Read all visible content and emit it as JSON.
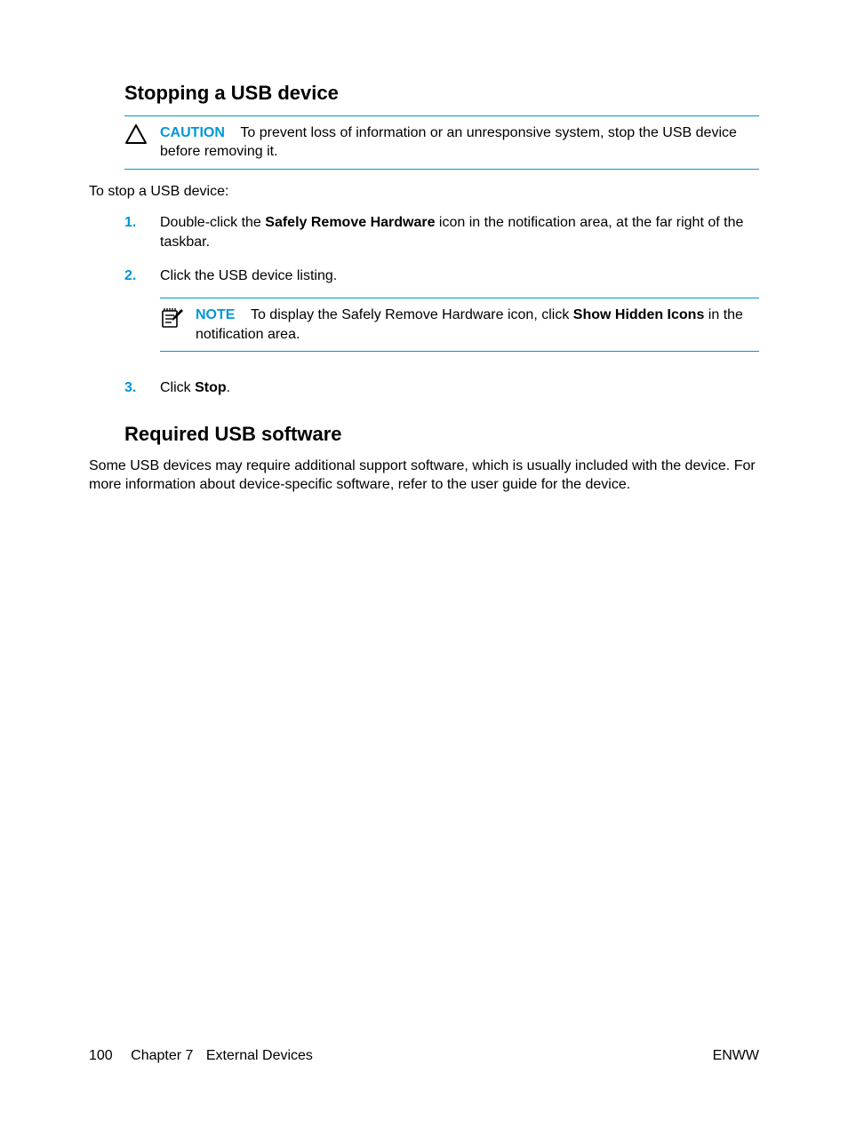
{
  "section1": {
    "heading": "Stopping a USB device",
    "caution": {
      "label": "CAUTION",
      "text1": "To prevent loss of information or an unresponsive system, stop the USB device before removing it."
    },
    "intro": "To stop a USB device:",
    "steps": {
      "s1a": "Double-click the ",
      "s1b": "Safely Remove Hardware",
      "s1c": " icon in the notification area, at the far right of the taskbar.",
      "s2": "Click the USB device listing.",
      "note": {
        "label": "NOTE",
        "t1": "To display the Safely Remove Hardware icon, click ",
        "t2": "Show Hidden Icons",
        "t3": " in the notification area."
      },
      "s3a": "Click ",
      "s3b": "Stop",
      "s3c": "."
    }
  },
  "section2": {
    "heading": "Required USB software",
    "para": "Some USB devices may require additional support software, which is usually included with the device. For more information about device-specific software, refer to the user guide for the device."
  },
  "footer": {
    "page": "100",
    "chapter": "Chapter 7",
    "title": "External Devices",
    "right": "ENWW"
  }
}
